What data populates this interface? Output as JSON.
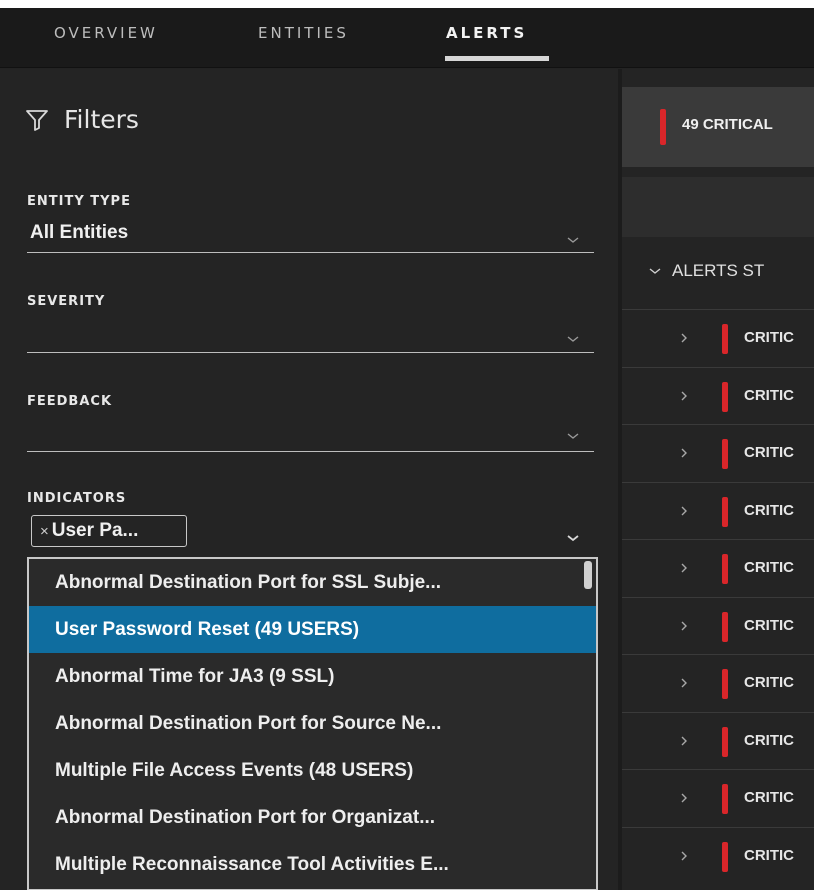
{
  "tabs": [
    {
      "label": "OVERVIEW"
    },
    {
      "label": "ENTITIES"
    },
    {
      "label": "ALERTS"
    }
  ],
  "filters": {
    "title": "Filters",
    "entity_type": {
      "label": "ENTITY TYPE",
      "value": "All Entities"
    },
    "severity": {
      "label": "SEVERITY",
      "value": ""
    },
    "feedback": {
      "label": "FEEDBACK",
      "value": ""
    },
    "indicators": {
      "label": "INDICATORS",
      "chip": "User Pa...",
      "chip_remove": "×",
      "options": [
        "Abnormal Destination Port for SSL Subje...",
        "User Password Reset (49 USERS)",
        "Abnormal Time for JA3 (9 SSL)",
        "Abnormal Destination Port for Source Ne...",
        "Multiple File Access Events (48 USERS)",
        "Abnormal Destination Port for Organizat...",
        "Multiple Reconnaissance Tool Activities E..."
      ],
      "selected_option": "User Password Reset (49 USERS)"
    }
  },
  "alerts_panel": {
    "summary": "49  CRITICAL",
    "group_label": "ALERTS ST",
    "rows": [
      "CRITIC",
      "CRITIC",
      "CRITIC",
      "CRITIC",
      "CRITIC",
      "CRITIC",
      "CRITIC",
      "CRITIC",
      "CRITIC",
      "CRITIC"
    ]
  },
  "colors": {
    "severity_critical": "#d9262a",
    "selection": "#0f6d9f",
    "background": "#242424"
  },
  "icons": [
    "funnel-icon",
    "chevron-down-icon",
    "chevron-right-icon",
    "close-icon"
  ]
}
